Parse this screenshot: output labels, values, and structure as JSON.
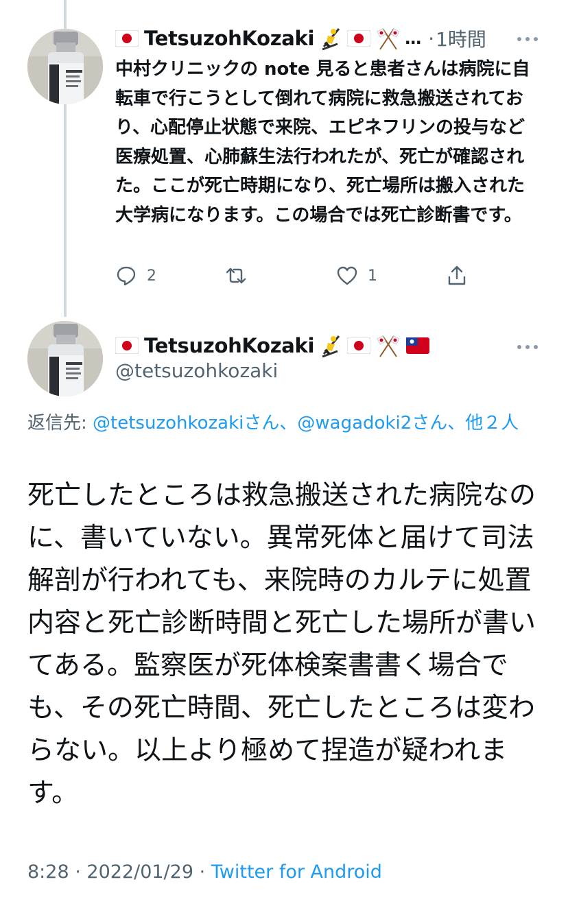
{
  "tweet1": {
    "display_name": "TetsuzohKozaki",
    "name_suffix": "…",
    "separator": "·",
    "time": "1時間",
    "text": "中村クリニックの note 見ると患者さんは病院に自転車で行こうとして倒れて病院に救急搬送されており、心配停止状態で来院、エピネフリンの投与など医療処置、心肺蘇生法行われたが、死亡が確認された。ここが死亡時期になり、死亡場所は搬入された大学病になります。この場合では死亡診断書です。",
    "reply_count": "2",
    "like_count": "1",
    "icons": [
      "reply-icon",
      "retweet-icon",
      "like-icon",
      "share-icon"
    ]
  },
  "tweet2": {
    "display_name": "TetsuzohKozaki",
    "handle": "@tetsuzohkozaki",
    "reply_label": "返信先: ",
    "reply_mention1": "@tetsuzohkozaki",
    "reply_san1": "さん、",
    "reply_mention2": "@wagadoki2",
    "reply_san2": "さん、",
    "reply_others": "他２人",
    "text": "死亡したところは救急搬送された病院なのに、書いていない。異常死体と届けて司法解剖が行われても、来院時のカルテに処置内容と死亡診断時間と死亡した場所が書いてある。監察医が死体検案書書く場合でも、その死亡時間、死亡したところは変わらない。以上より極めて捏造が疑われます。",
    "time": "8:28",
    "dot": " · ",
    "date": "2022/01/29",
    "dot2": " · ",
    "source": "Twitter for Android"
  },
  "colors": {
    "link": "#1d9bf0",
    "secondary": "#536471",
    "text": "#0f1419"
  }
}
